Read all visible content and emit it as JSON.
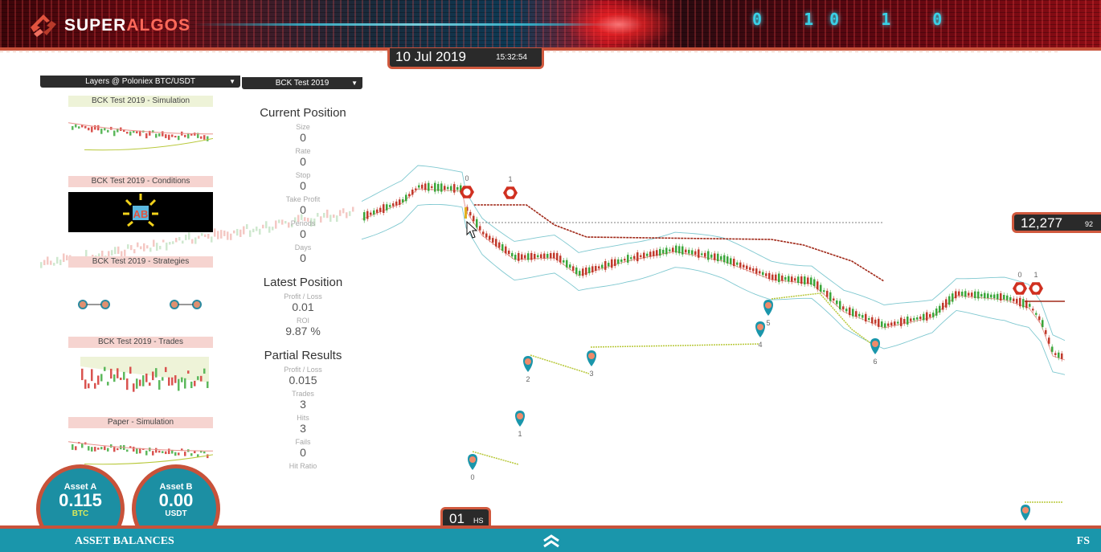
{
  "header": {
    "brand_a": "SUPER",
    "brand_b": "ALGOS",
    "binary": "0 10 1 0"
  },
  "datetime": {
    "date": "10 Jul 2019",
    "time": "15:32:54"
  },
  "dropdowns": {
    "layers": "Layers @ Poloniex BTC/USDT",
    "bck": "BCK Test 2019"
  },
  "layers": [
    {
      "title": "BCK Test 2019 - Simulation"
    },
    {
      "title": "BCK Test 2019 - Conditions"
    },
    {
      "title": "BCK Test 2019 - Strategies"
    },
    {
      "title": "BCK Test 2019 - Trades"
    },
    {
      "title": "Paper - Simulation"
    }
  ],
  "current_position": {
    "heading": "Current Position",
    "rows": [
      {
        "label": "Size",
        "value": "0"
      },
      {
        "label": "Rate",
        "value": "0"
      },
      {
        "label": "Stop",
        "value": "0"
      },
      {
        "label": "Take Profit",
        "value": "0"
      },
      {
        "label": "Periods",
        "value": "0"
      },
      {
        "label": "Days",
        "value": "0"
      }
    ]
  },
  "latest_position": {
    "heading": "Latest Position",
    "rows": [
      {
        "label": "Profit / Loss",
        "value": "0.01"
      },
      {
        "label": "ROI",
        "value": "9.87 %"
      }
    ]
  },
  "partial_results": {
    "heading": "Partial Results",
    "rows": [
      {
        "label": "Profit / Loss",
        "value": "0.015"
      },
      {
        "label": "Trades",
        "value": "3"
      },
      {
        "label": "Hits",
        "value": "3"
      },
      {
        "label": "Fails",
        "value": "0"
      },
      {
        "label": "Hit Ratio",
        "value": ""
      }
    ]
  },
  "price": {
    "value": "12,277",
    "cents": "92"
  },
  "timeframe": {
    "value": "01",
    "unit": "HS"
  },
  "assets": [
    {
      "name": "Asset A",
      "value": "0.115",
      "currency": "BTC"
    },
    {
      "name": "Asset B",
      "value": "0.00",
      "currency": "USDT"
    }
  ],
  "bottom_bar": {
    "left_label": "ASSET BALANCES",
    "right_label": "FS"
  },
  "markers": {
    "strategy_labels": [
      "0",
      "1",
      "0",
      "1"
    ],
    "trade_labels": [
      "0",
      "1",
      "2",
      "3",
      "4",
      "5",
      "6"
    ]
  },
  "colors": {
    "accent": "#c8523a",
    "teal": "#1a96ab",
    "bull": "#3aa63a",
    "bear": "#c0392b",
    "band": "#7fc8d0",
    "stop": "#a02818",
    "target": "#b8c83a"
  }
}
